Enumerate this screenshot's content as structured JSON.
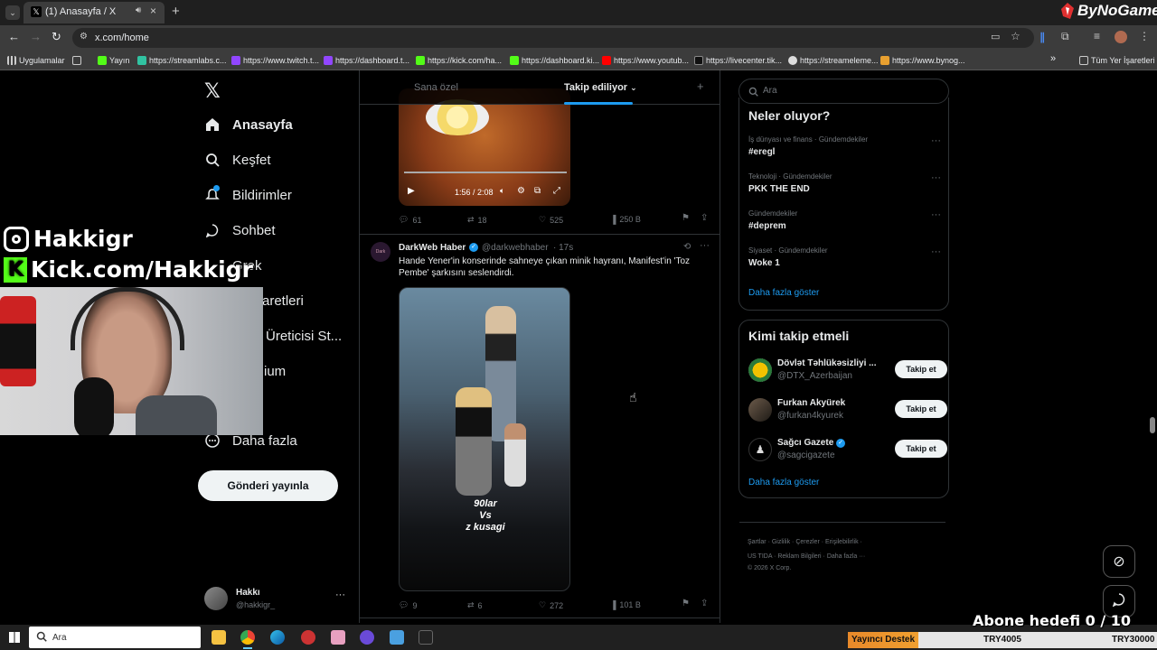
{
  "browser": {
    "tab_title": "(1) Anasayfa / X",
    "url": "x.com/home",
    "bookmarks": [
      "Uygulamalar",
      "Yayın",
      "https://streamlabs.c...",
      "https://www.twitch.t...",
      "https://dashboard.t...",
      "https://kick.com/ha...",
      "https://dashboard.ki...",
      "https://www.youtub...",
      "https://livecenter.tik...",
      "https://streameleme...",
      "https://www.bynog..."
    ],
    "all_bookmarks": "Tüm Yer İşaretleri"
  },
  "brand_overlay": "ByNoGame",
  "stream_overlay": {
    "instagram": "Hakkigr",
    "kick": "Kick.com/Hakkigr",
    "goal": "Abone hedefi 0 / 10"
  },
  "sidebar": {
    "items": [
      {
        "label": "Anasayfa",
        "icon": "home-icon"
      },
      {
        "label": "Keşfet",
        "icon": "search-icon"
      },
      {
        "label": "Bildirimler",
        "icon": "bell-icon"
      },
      {
        "label": "Sohbet",
        "icon": "chat-icon"
      },
      {
        "label": "Grok",
        "icon": "grok-icon"
      },
      {
        "label": "aretleri",
        "icon": "bookmark-icon"
      },
      {
        "label": "Üreticisi St...",
        "icon": "creator-icon"
      },
      {
        "label": "ium",
        "icon": "premium-icon"
      },
      {
        "label": "Daha fazla",
        "icon": "more-circle-icon"
      }
    ],
    "post_button": "Gönderi yayınla",
    "account": {
      "name": "Hakkı",
      "handle": "@hakkigr_"
    }
  },
  "feed": {
    "tabs": [
      "Sana özel",
      "Takip ediliyor"
    ],
    "video1": {
      "time": "1:56 / 2:08",
      "actions": {
        "replies": "61",
        "reposts": "18",
        "likes": "525",
        "views": "250 B"
      }
    },
    "tweet": {
      "author": "DarkWeb Haber",
      "handle": "@darkwebhaber",
      "time": "· 17s",
      "text": "Hande Yener'in konserinde sahneye çıkan minik hayranı, Manifest'in 'Toz Pembe' şarkısını seslendirdi.",
      "video_caption": [
        "90lar",
        "Vs",
        "z kusagi"
      ],
      "actions": {
        "replies": "9",
        "reposts": "6",
        "likes": "272",
        "views": "101 B"
      }
    }
  },
  "right": {
    "search_placeholder": "Ara",
    "trends_title": "Neler oluyor?",
    "trends": [
      {
        "category": "İş dünyası ve finans · Gündemdekiler",
        "name": "#eregl"
      },
      {
        "category": "Teknoloji · Gündemdekiler",
        "name": "PKK THE END"
      },
      {
        "category": "Gündemdekiler",
        "name": "#deprem"
      },
      {
        "category": "Siyaset · Gündemdekiler",
        "name": "Woke 1"
      }
    ],
    "show_more": "Daha fazla göster",
    "who_title": "Kimi takip etmeli",
    "who": [
      {
        "name": "Dövlət Təhlükəsizliyi ...",
        "handle": "@DTX_Azerbaijan"
      },
      {
        "name": "Furkan Akyürek",
        "handle": "@furkan4kyurek"
      },
      {
        "name": "Sağcı Gazete",
        "handle": "@sagcigazete"
      }
    ],
    "follow_label": "Takip et",
    "footer": {
      "line1": [
        "Şartlar",
        "Gizlilik",
        "Çerezler",
        "Erişilebilirlik"
      ],
      "line2": [
        "US TIDA",
        "Reklam Bilgileri",
        "Daha fazla ···"
      ],
      "copyright": "© 2026 X Corp."
    }
  },
  "taskbar": {
    "search": "Ara",
    "ticker": [
      {
        "label": "Yayıncı Destek"
      },
      {
        "label": "TRY4005"
      },
      {
        "label": "TRY30000"
      }
    ]
  },
  "colors": {
    "accent": "#1d9bf0",
    "verified": "#1d9bf0",
    "ticker_bg": "#f0a030"
  }
}
